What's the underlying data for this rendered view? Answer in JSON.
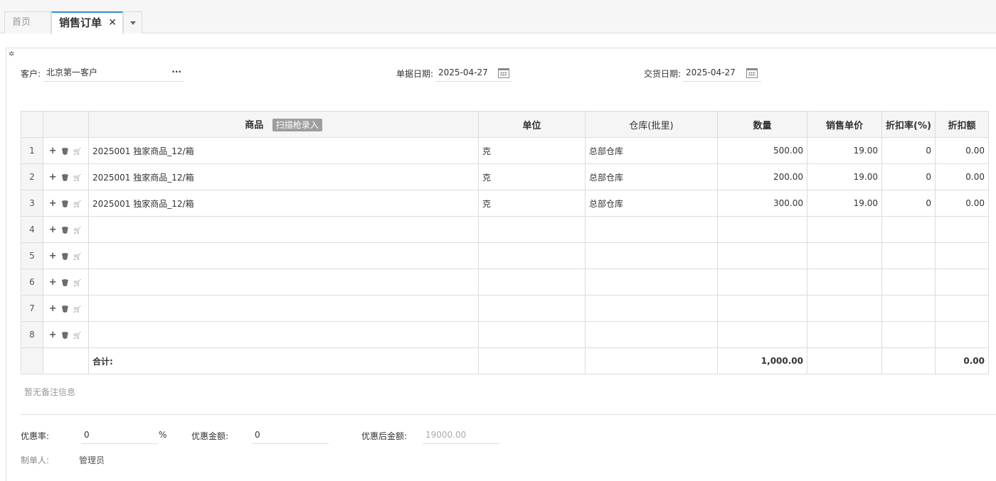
{
  "tabs": {
    "home": "首页",
    "active": "销售订单",
    "close": "✕"
  },
  "header": {
    "customer_label": "客户:",
    "customer_value": "北京第一客户",
    "customer_more": "···",
    "bill_date_label": "单据日期:",
    "bill_date_value": "2025-04-27",
    "delivery_date_label": "交货日期:",
    "delivery_date_value": "2025-04-27"
  },
  "table": {
    "columns": [
      "商品",
      "单位",
      "仓库(批里)",
      "数量",
      "销售单价",
      "折扣率(%)",
      "折扣额"
    ],
    "scan_button": "扫描枪录入",
    "rows": [
      {
        "no": "1",
        "product": "2025001 独家商品_12/箱",
        "unit": "克",
        "warehouse": "总部仓库",
        "qty": "500.00",
        "price": "19.00",
        "rate": "0",
        "discount": "0.00"
      },
      {
        "no": "2",
        "product": "2025001 独家商品_12/箱",
        "unit": "克",
        "warehouse": "总部仓库",
        "qty": "200.00",
        "price": "19.00",
        "rate": "0",
        "discount": "0.00"
      },
      {
        "no": "3",
        "product": "2025001 独家商品_12/箱",
        "unit": "克",
        "warehouse": "总部仓库",
        "qty": "300.00",
        "price": "19.00",
        "rate": "0",
        "discount": "0.00"
      },
      {
        "no": "4",
        "product": "",
        "unit": "",
        "warehouse": "",
        "qty": "",
        "price": "",
        "rate": "",
        "discount": ""
      },
      {
        "no": "5",
        "product": "",
        "unit": "",
        "warehouse": "",
        "qty": "",
        "price": "",
        "rate": "",
        "discount": ""
      },
      {
        "no": "6",
        "product": "",
        "unit": "",
        "warehouse": "",
        "qty": "",
        "price": "",
        "rate": "",
        "discount": ""
      },
      {
        "no": "7",
        "product": "",
        "unit": "",
        "warehouse": "",
        "qty": "",
        "price": "",
        "rate": "",
        "discount": ""
      },
      {
        "no": "8",
        "product": "",
        "unit": "",
        "warehouse": "",
        "qty": "",
        "price": "",
        "rate": "",
        "discount": ""
      }
    ],
    "total_label": "合计:",
    "total_qty": "1,000.00",
    "total_discount": "0.00"
  },
  "note": "暂无备注信息",
  "footer": {
    "discount_rate_label": "优惠率:",
    "discount_rate_value": "0",
    "percent": "%",
    "discount_amount_label": "优惠金额:",
    "discount_amount_value": "0",
    "after_discount_label": "优惠后金额:",
    "after_discount_value": "19000.00",
    "maker_label": "制单人:",
    "maker_value": "管理员"
  }
}
